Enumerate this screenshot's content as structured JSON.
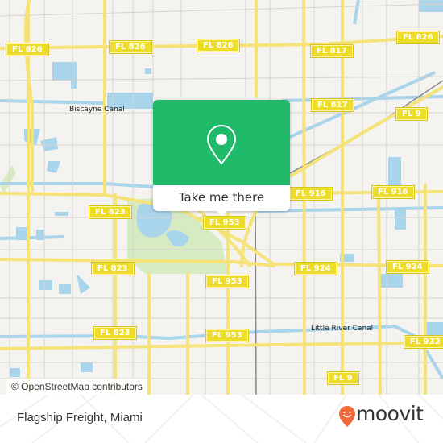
{
  "map": {
    "colors": {
      "land": "#f4f3ef",
      "water": "#a8d4ec",
      "park": "#d7ebc2",
      "road_major": "#f5e37a",
      "road_minor": "#d6d3cc",
      "shield": "#eedc2a",
      "accent_green": "#1fba6a",
      "brand_orange": "#f26a3b"
    },
    "route_shields": [
      {
        "label": "FL 826"
      },
      {
        "label": "FL 826"
      },
      {
        "label": "FL 826"
      },
      {
        "label": "FL 817"
      },
      {
        "label": "FL 817"
      },
      {
        "label": "FL 9"
      },
      {
        "label": "FL 823"
      },
      {
        "label": "FL 823"
      },
      {
        "label": "FL 823"
      },
      {
        "label": "FL 953"
      },
      {
        "label": "FL 953"
      },
      {
        "label": "FL 953"
      },
      {
        "label": "FL 916"
      },
      {
        "label": "FL 916"
      },
      {
        "label": "FL 924"
      },
      {
        "label": "FL 924"
      },
      {
        "label": "FL 932"
      },
      {
        "label": "FL 9"
      }
    ],
    "labels": [
      {
        "text": "Biscayne Canal"
      },
      {
        "text": "Little River Canal"
      }
    ]
  },
  "popup": {
    "icon": "map-pin-icon",
    "button_label": "Take me there"
  },
  "attribution": "© OpenStreetMap contributors",
  "footer": {
    "place_name": "Flagship Freight, Miami",
    "brand": "moovit",
    "brand_icon": "moovit-smile-pin-icon"
  }
}
